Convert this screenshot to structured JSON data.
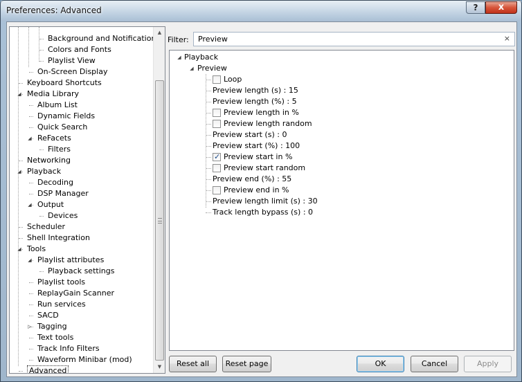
{
  "window": {
    "title": "Preferences: Advanced",
    "help_label": "?",
    "close_label": "x"
  },
  "sidebar": {
    "items": [
      {
        "label": "Background and Notifications",
        "level": 2
      },
      {
        "label": "Colors and Fonts",
        "level": 2
      },
      {
        "label": "Playlist View",
        "level": 2
      },
      {
        "label": "On-Screen Display",
        "level": 1
      },
      {
        "label": "Keyboard Shortcuts",
        "level": 0
      },
      {
        "label": "Media Library",
        "level": 0,
        "expanded": true
      },
      {
        "label": "Album List",
        "level": 1
      },
      {
        "label": "Dynamic Fields",
        "level": 1
      },
      {
        "label": "Quick Search",
        "level": 1
      },
      {
        "label": "ReFacets",
        "level": 1,
        "expanded": true
      },
      {
        "label": "Filters",
        "level": 2
      },
      {
        "label": "Networking",
        "level": 0
      },
      {
        "label": "Playback",
        "level": 0,
        "expanded": true
      },
      {
        "label": "Decoding",
        "level": 1
      },
      {
        "label": "DSP Manager",
        "level": 1
      },
      {
        "label": "Output",
        "level": 1,
        "expanded": true
      },
      {
        "label": "Devices",
        "level": 2
      },
      {
        "label": "Scheduler",
        "level": 0
      },
      {
        "label": "Shell Integration",
        "level": 0
      },
      {
        "label": "Tools",
        "level": 0,
        "expanded": true
      },
      {
        "label": "Playlist attributes",
        "level": 1,
        "expanded": true
      },
      {
        "label": "Playback settings",
        "level": 2
      },
      {
        "label": "Playlist tools",
        "level": 1
      },
      {
        "label": "ReplayGain Scanner",
        "level": 1
      },
      {
        "label": "Run services",
        "level": 1
      },
      {
        "label": "SACD",
        "level": 1
      },
      {
        "label": "Tagging",
        "level": 1,
        "collapsed": true
      },
      {
        "label": "Text tools",
        "level": 1
      },
      {
        "label": "Track Info Filters",
        "level": 1
      },
      {
        "label": "Waveform Minibar (mod)",
        "level": 1
      },
      {
        "label": "Advanced",
        "level": 0,
        "selected": true
      }
    ]
  },
  "filter": {
    "label": "Filter:",
    "value": "Preview",
    "clear_label": "×"
  },
  "advanced_tree": {
    "root": "Playback",
    "group": "Preview",
    "items": [
      {
        "label": "Loop",
        "type": "checkbox",
        "checked": false
      },
      {
        "label": "Preview length (s) : 15",
        "type": "value"
      },
      {
        "label": "Preview length (%) : 5",
        "type": "value"
      },
      {
        "label": "Preview length in %",
        "type": "checkbox",
        "checked": false
      },
      {
        "label": "Preview length random",
        "type": "checkbox",
        "checked": false
      },
      {
        "label": "Preview start (s) : 0",
        "type": "value"
      },
      {
        "label": "Preview start (%) : 100",
        "type": "value"
      },
      {
        "label": "Preview start in %",
        "type": "checkbox",
        "checked": true
      },
      {
        "label": "Preview start random",
        "type": "checkbox",
        "checked": false
      },
      {
        "label": "Preview end (%) : 55",
        "type": "value"
      },
      {
        "label": "Preview end in %",
        "type": "checkbox",
        "checked": false
      },
      {
        "label": "Preview length limit (s) : 30",
        "type": "value"
      },
      {
        "label": "Track length bypass (s) : 0",
        "type": "value"
      }
    ]
  },
  "buttons": {
    "reset_all": "Reset all",
    "reset_page": "Reset page",
    "ok": "OK",
    "cancel": "Cancel",
    "apply": "Apply"
  }
}
